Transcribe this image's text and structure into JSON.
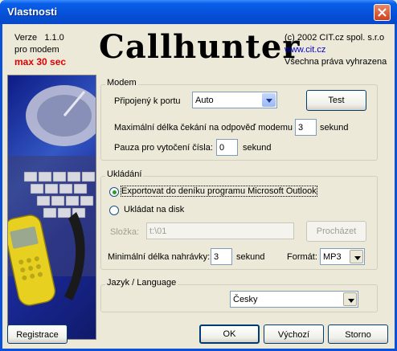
{
  "window": {
    "title": "Vlastnosti"
  },
  "header": {
    "version_label": "Verze",
    "version": "1.1.0",
    "subtitle": "pro modem",
    "limit": "max 30 sec",
    "brand": "Callhunter",
    "copyright": "(c) 2002 CIT.cz spol. s.r.o",
    "url": "www.cit.cz",
    "rights": "Všechna práva vyhrazena"
  },
  "modem": {
    "legend": "Modem",
    "port_label": "Připojený k portu",
    "port_value": "Auto",
    "test_button": "Test",
    "wait_label": "Maximální délka čekání na odpověď modemu",
    "wait_value": "3",
    "wait_unit": "sekund",
    "pause_label": "Pauza pro vytočení čísla:",
    "pause_value": "0",
    "pause_unit": "sekund"
  },
  "storage": {
    "legend": "Ukládání",
    "option_outlook": "Exportovat do deníku programu Microsoft Outlook",
    "option_disk": "Ukládat na disk",
    "selected": "outlook",
    "folder_label": "Složka:",
    "folder_value": "t:\\01",
    "browse_button": "Procházet",
    "min_length_label": "Minimální délka nahrávky:",
    "min_length_value": "3",
    "min_length_unit": "sekund",
    "format_label": "Formát:",
    "format_value": "MP3"
  },
  "language": {
    "legend": "Jazyk / Language",
    "value": "Česky"
  },
  "footer": {
    "register_button": "Registrace",
    "ok_button": "OK",
    "default_button": "Výchozí",
    "cancel_button": "Storno"
  },
  "colors": {
    "titlebar": "#0550d8",
    "limit_text": "#e00000",
    "link": "#0000cc"
  }
}
